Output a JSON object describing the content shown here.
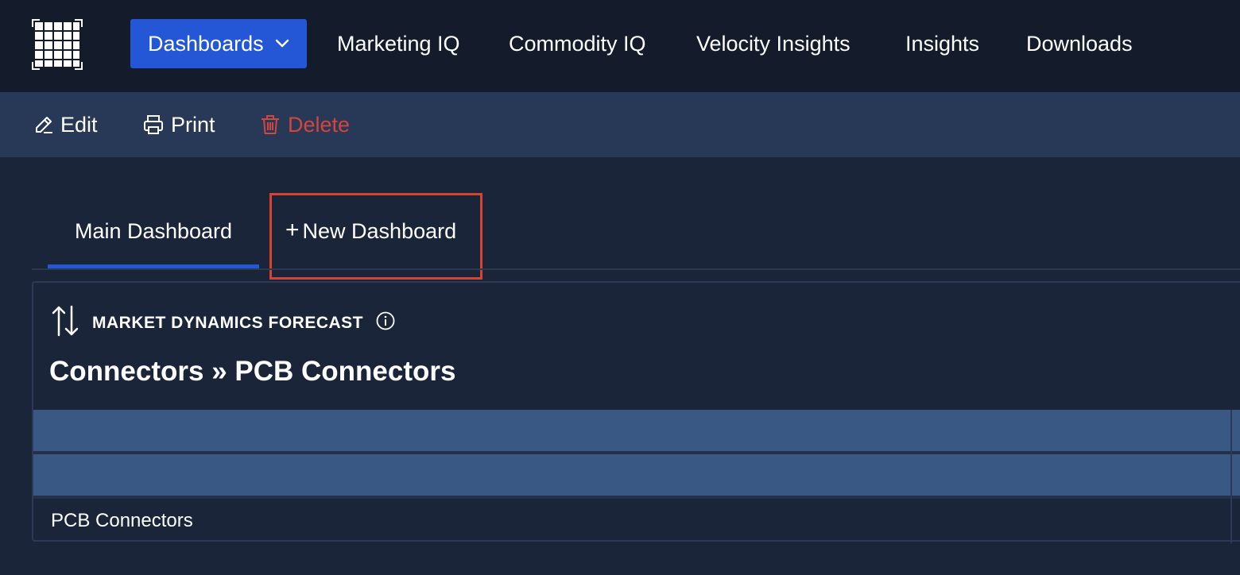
{
  "topnav": {
    "logo_icon": "grid-logo-icon",
    "items": [
      {
        "label": "Dashboards",
        "active": true,
        "icon": "chevron-down-icon"
      },
      {
        "label": "Marketing IQ"
      },
      {
        "label": "Commodity IQ"
      },
      {
        "label": "Velocity Insights"
      },
      {
        "label": "Insights"
      },
      {
        "label": "Downloads"
      }
    ]
  },
  "toolbar": {
    "edit_label": "Edit",
    "edit_icon": "pencil-icon",
    "print_label": "Print",
    "print_icon": "printer-icon",
    "delete_label": "Delete",
    "delete_icon": "trash-icon"
  },
  "tabs": {
    "main_label": "Main Dashboard",
    "new_label": "New Dashboard",
    "new_icon": "plus-icon"
  },
  "card": {
    "header_icon": "sort-arrows-icon",
    "header_label": "MARKET DYNAMICS FORECAST",
    "info_icon": "info-icon",
    "title": "Connectors » PCB Connectors",
    "rows": [
      {
        "label": ""
      },
      {
        "label": ""
      },
      {
        "label": "PCB Connectors"
      }
    ]
  },
  "colors": {
    "nav_bg": "#141c2b",
    "toolbar_bg": "#283857",
    "page_bg": "#1b2539",
    "accent": "#2457d6",
    "danger": "#d2463b",
    "highlight_border": "#d8432f",
    "table_header": "#3a5884"
  }
}
